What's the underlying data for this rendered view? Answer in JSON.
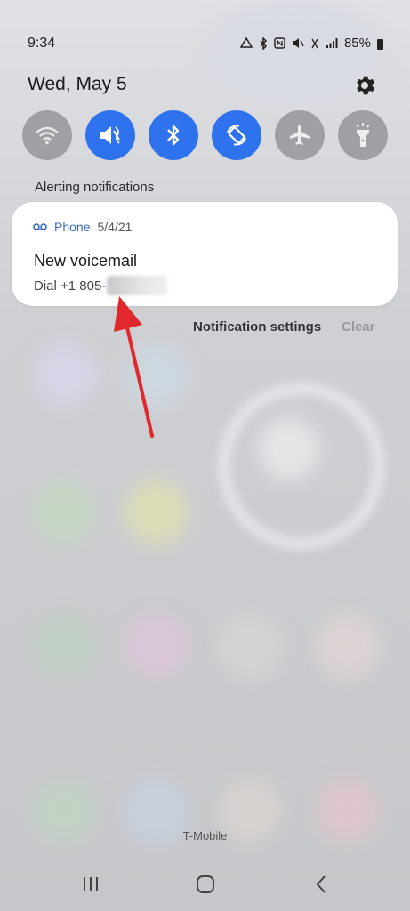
{
  "status_bar": {
    "time": "9:34",
    "battery_percent": "85%",
    "icons": [
      "drive-sync-icon",
      "bluetooth-icon",
      "nfc-icon",
      "mute-icon",
      "wifi-calling-icon",
      "signal-icon",
      "battery-icon"
    ]
  },
  "header": {
    "date": "Wed, May 5",
    "settings_icon": "gear-icon"
  },
  "quick_toggles": [
    {
      "name": "wifi",
      "icon": "wifi-icon",
      "state": "off"
    },
    {
      "name": "mute",
      "icon": "mute-icon",
      "state": "on"
    },
    {
      "name": "bluetooth",
      "icon": "bluetooth-icon",
      "state": "on"
    },
    {
      "name": "auto-rotate",
      "icon": "auto-rotate-icon",
      "state": "on"
    },
    {
      "name": "airplane-mode",
      "icon": "airplane-icon",
      "state": "off"
    },
    {
      "name": "flashlight",
      "icon": "flashlight-icon",
      "state": "off"
    }
  ],
  "notifications": {
    "section_title": "Alerting notifications",
    "items": [
      {
        "app_name": "Phone",
        "app_icon": "voicemail-icon",
        "date": "5/4/21",
        "title": "New voicemail",
        "body": "Dial +1 805-"
      }
    ],
    "settings_label": "Notification settings",
    "clear_label": "Clear"
  },
  "carrier": "T-Mobile",
  "colors": {
    "toggle_on": "#2e72ee",
    "toggle_off": "#9fa0a3",
    "app_name": "#3b6ebd",
    "annotation_arrow": "#e0282d"
  },
  "nav_bar": [
    "recents-icon",
    "home-icon",
    "back-icon"
  ]
}
